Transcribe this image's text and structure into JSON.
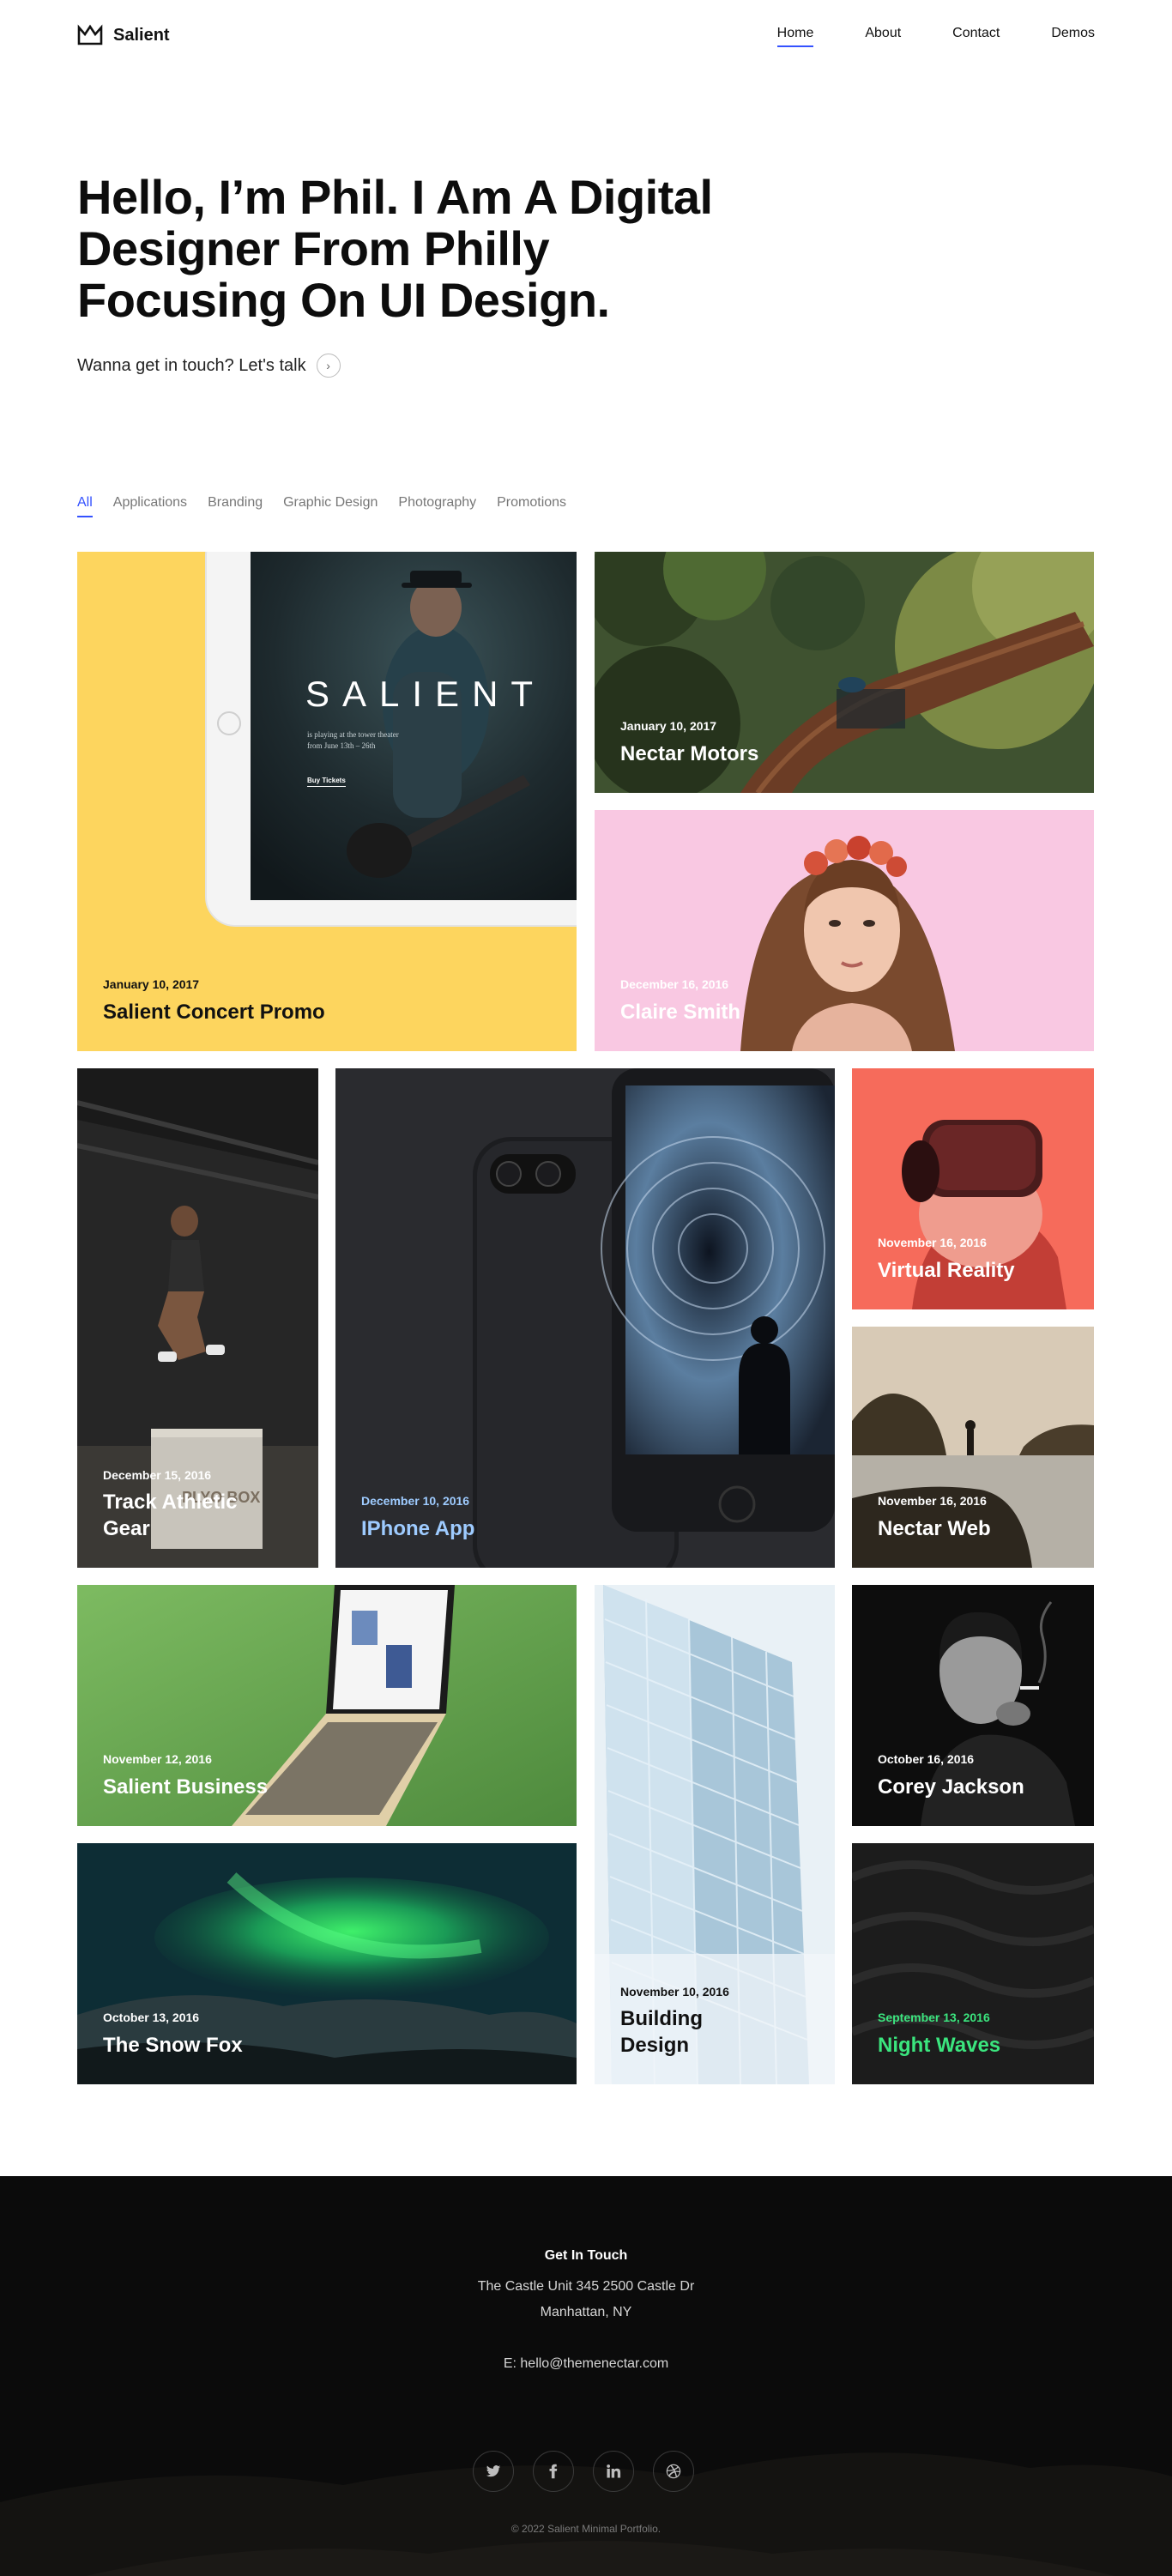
{
  "header": {
    "logo_text": "Salient",
    "nav": [
      {
        "label": "Home",
        "active": true
      },
      {
        "label": "About"
      },
      {
        "label": "Contact"
      },
      {
        "label": "Demos"
      }
    ]
  },
  "hero": {
    "title": "Hello, I’m Phil. I Am A Digital Designer From Philly Focusing On UI Design.",
    "cta": "Wanna get in touch? Let's talk"
  },
  "filters": [
    "All",
    "Applications",
    "Branding",
    "Graphic Design",
    "Photography",
    "Promotions"
  ],
  "projects": [
    {
      "date": "January 10, 2017",
      "title": "Salient Concert Promo",
      "ipad_brand": "SALIENT",
      "ipad_sub": "is playing at the tower theater",
      "ipad_dates": "from June 13th – 26th",
      "ipad_button": "Buy Tickets"
    },
    {
      "date": "January 10, 2017",
      "title": "Nectar Motors"
    },
    {
      "date": "December 16, 2016",
      "title": "Claire Smith"
    },
    {
      "date": "December 15, 2016",
      "title": "Track Athletic Gear",
      "box_text": "PLYO BOX"
    },
    {
      "date": "December 10, 2016",
      "title": "IPhone App"
    },
    {
      "date": "November 16, 2016",
      "title": "Virtual Reality"
    },
    {
      "date": "November 16, 2016",
      "title": "Nectar Web"
    },
    {
      "date": "November 12, 2016",
      "title": "Salient Business"
    },
    {
      "date": "November 10, 2016",
      "title": "Building Design"
    },
    {
      "date": "October 16, 2016",
      "title": "Corey Jackson"
    },
    {
      "date": "October 13, 2016",
      "title": "The Snow Fox"
    },
    {
      "date": "September 13, 2016",
      "title": "Night Waves"
    }
  ],
  "footer": {
    "heading": "Get In Touch",
    "address_1": "The Castle Unit 345 2500 Castle Dr",
    "address_2": "Manhattan, NY",
    "email": "E: hello@themenectar.com",
    "socials": [
      "twitter-icon",
      "facebook-icon",
      "linkedin-icon",
      "dribbble-icon"
    ],
    "copyright": "© 2022 Salient Minimal Portfolio."
  },
  "colors": {
    "accent": "#3452ff",
    "iphone_title": "#9ecbff",
    "night_waves_title": "#3be57e"
  }
}
